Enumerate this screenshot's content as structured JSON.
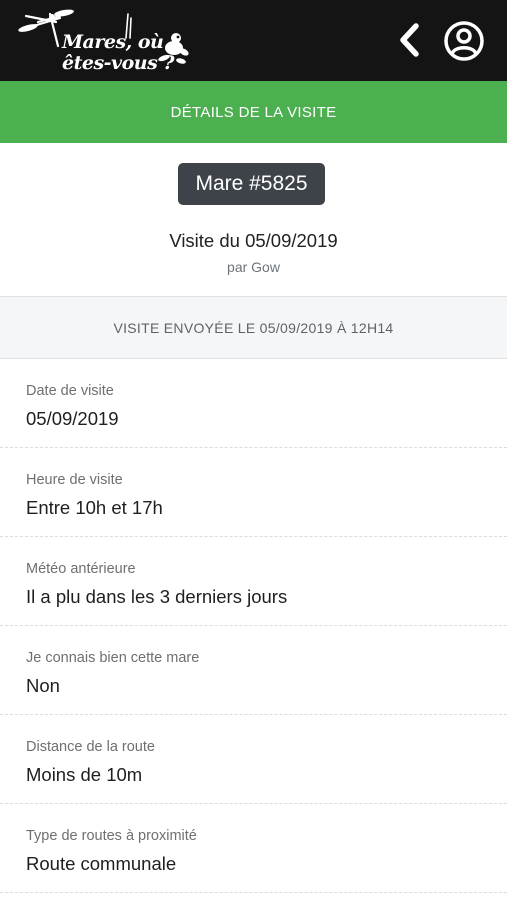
{
  "brand": {
    "line1": "Mares, où",
    "line2": "êtes-vous ?"
  },
  "icons": {
    "logo": "dragonfly-and-frog-logo",
    "back": "chevron-left-icon",
    "account": "user-circle-icon"
  },
  "colors": {
    "topbar": "#141414",
    "accent_green": "#4caf50",
    "badge": "#3d4348"
  },
  "section_title": "DÉTAILS DE LA VISITE",
  "mare": {
    "badge": "Mare #5825"
  },
  "visit": {
    "title": "Visite du 05/09/2019",
    "by": "par Gow",
    "sent": "VISITE ENVOYÉE LE 05/09/2019 À 12H14"
  },
  "details": [
    {
      "label": "Date de visite",
      "value": "05/09/2019"
    },
    {
      "label": "Heure de visite",
      "value": "Entre 10h et 17h"
    },
    {
      "label": "Météo antérieure",
      "value": "Il a plu dans les 3 derniers jours"
    },
    {
      "label": "Je connais bien cette mare",
      "value": "Non"
    },
    {
      "label": "Distance de la route",
      "value": "Moins de 10m"
    },
    {
      "label": "Type de routes à proximité",
      "value": "Route communale"
    }
  ]
}
